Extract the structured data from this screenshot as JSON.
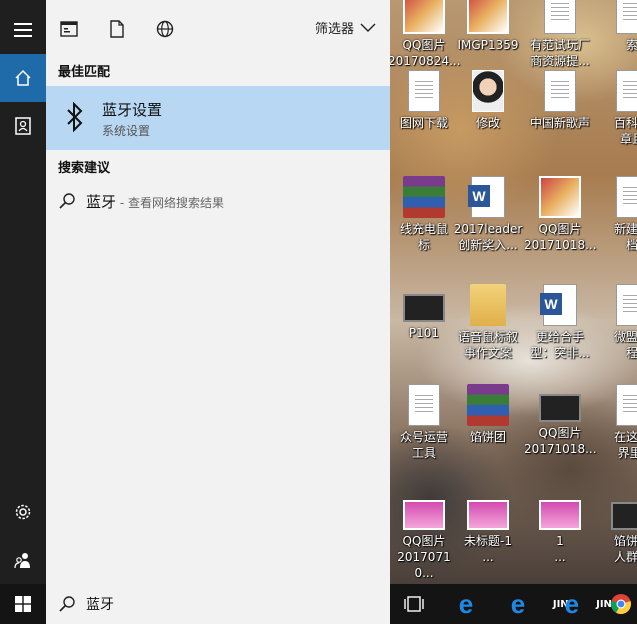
{
  "start_menu": {
    "toolbar": {
      "icons": [
        "apps-icon",
        "document-icon",
        "globe-icon"
      ],
      "filter_label": "筛选器"
    },
    "best_match": {
      "section_title": "最佳匹配",
      "item_name": "蓝牙设置",
      "item_subtitle": "系统设置",
      "icon": "bluetooth-icon"
    },
    "suggestions": {
      "section_title": "搜索建议",
      "query": "蓝牙",
      "hint": " - 查看网络搜索结果"
    },
    "sidebar_icons": [
      "hamburger-icon",
      "home-icon",
      "user-doc-icon",
      "gear-icon",
      "people-icon"
    ]
  },
  "search": {
    "value": "蓝牙"
  },
  "desktop": {
    "icons": [
      {
        "label": "QQ图片\n20170824...",
        "kind": "pic"
      },
      {
        "label": "IMGP1359",
        "kind": "pic"
      },
      {
        "label": "有范试玩厂\n商资源提...",
        "kind": "doc"
      },
      {
        "label": "索",
        "kind": "doc"
      },
      {
        "label": "图网下载",
        "kind": "doc"
      },
      {
        "label": "修改",
        "kind": "face"
      },
      {
        "label": "中国新歌声",
        "kind": "doc"
      },
      {
        "label": "百科数\n章且",
        "kind": "doc"
      },
      {
        "label": "线充电鼠\n标",
        "kind": "rar"
      },
      {
        "label": "2017leader\n创新奖入...",
        "kind": "word"
      },
      {
        "label": "QQ图片\n20171018...",
        "kind": "pic"
      },
      {
        "label": "新建文\n档",
        "kind": "doc"
      },
      {
        "label": "P101",
        "kind": "video"
      },
      {
        "label": "语音鼠标叙\n事作文案",
        "kind": "folder"
      },
      {
        "label": "更给合手\n型：突非...",
        "kind": "word"
      },
      {
        "label": "微盟智\n程",
        "kind": "doc"
      },
      {
        "label": "众号运营\n工具",
        "kind": "doc"
      },
      {
        "label": "馅饼团",
        "kind": "rar"
      },
      {
        "label": "QQ图片\n20171018...",
        "kind": "video"
      },
      {
        "label": "在这复\n界里(",
        "kind": "doc"
      },
      {
        "label": "QQ图片\n2017071 0...",
        "kind": "pink"
      },
      {
        "label": "未标题-1\n...",
        "kind": "pink"
      },
      {
        "label": "1\n...",
        "kind": "pink"
      },
      {
        "label": "馅饼理\n人群莱",
        "kind": "video"
      }
    ]
  },
  "taskbar": {
    "apps": [
      "task-view-icon",
      "edge-icon",
      "edge-icon",
      "jin-edge-icon",
      "chrome-icon"
    ],
    "jin_label": "JIN"
  },
  "colors": {
    "accent": "#1f6aa8",
    "selected_row": "#b8d7f2",
    "panel_bg": "#f2f2f2",
    "sidebar_bg": "#1f1f1f",
    "taskbar_bg": "#141414"
  }
}
